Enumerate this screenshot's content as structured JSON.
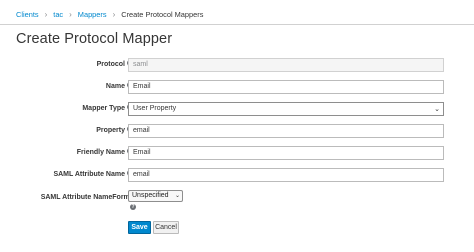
{
  "breadcrumb": {
    "items": [
      "Clients",
      "tac",
      "Mappers"
    ],
    "current": "Create Protocol Mappers"
  },
  "page_title": "Create Protocol Mapper",
  "form": {
    "protocol": {
      "label": "Protocol",
      "value": "saml"
    },
    "name": {
      "label": "Name",
      "value": "Email"
    },
    "mapper_type": {
      "label": "Mapper Type",
      "value": "User Property"
    },
    "property": {
      "label": "Property",
      "value": "email"
    },
    "friendly_name": {
      "label": "Friendly Name",
      "value": "Email"
    },
    "saml_attribute_name": {
      "label": "SAML Attribute Name",
      "value": "email"
    },
    "saml_attribute_nameformat": {
      "label": "SAML Attribute NameFormat",
      "value": "Unspecified"
    }
  },
  "buttons": {
    "save": "Save",
    "cancel": "Cancel"
  },
  "icons": {
    "help": "help-circle-icon",
    "select": "chevron-down-icon"
  },
  "colors": {
    "accent": "#0088ce",
    "text": "#363636",
    "muted": "#8b8d8f",
    "border": "#bbbbbb"
  }
}
